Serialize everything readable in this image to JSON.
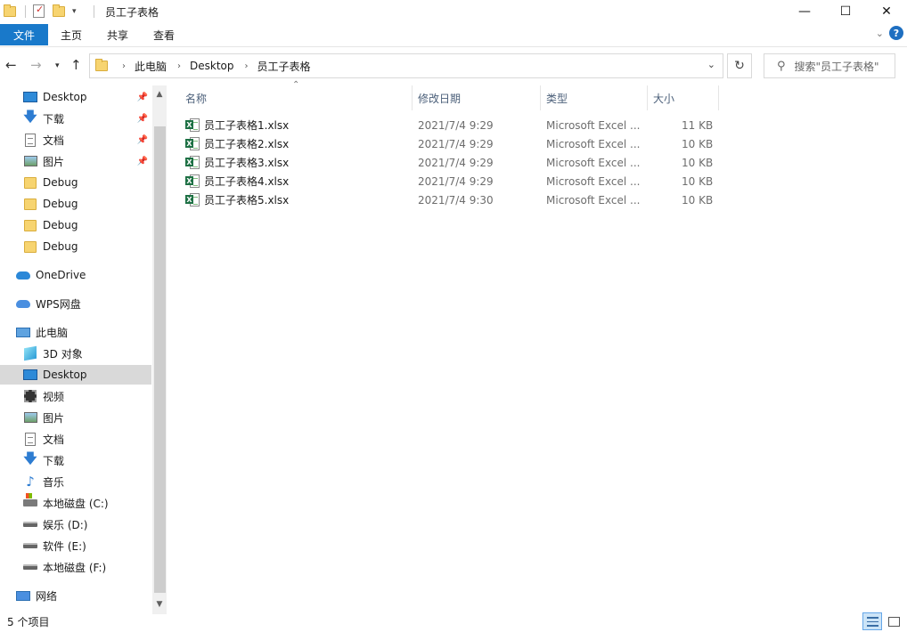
{
  "window": {
    "title": "员工子表格",
    "controls": {
      "minimize": "—",
      "maximize": "☐",
      "close": "✕"
    }
  },
  "ribbon": {
    "tabs": [
      "文件",
      "主页",
      "共享",
      "查看"
    ],
    "help": "?"
  },
  "address": {
    "breadcrumb": [
      "此电脑",
      "Desktop",
      "员工子表格"
    ],
    "search_placeholder": "搜索\"员工子表格\""
  },
  "sidebar": {
    "quick_access": [
      {
        "label": "Desktop",
        "icon": "desktop-icon",
        "pinned": true
      },
      {
        "label": "下载",
        "icon": "download-arrow-icon",
        "pinned": true
      },
      {
        "label": "文档",
        "icon": "document-icon",
        "pinned": true
      },
      {
        "label": "图片",
        "icon": "picture-icon",
        "pinned": true
      },
      {
        "label": "Debug",
        "icon": "folder-icon",
        "pinned": false
      },
      {
        "label": "Debug",
        "icon": "folder-icon",
        "pinned": false
      },
      {
        "label": "Debug",
        "icon": "folder-icon",
        "pinned": false
      },
      {
        "label": "Debug",
        "icon": "folder-icon",
        "pinned": false
      }
    ],
    "onedrive": "OneDrive",
    "wps": "WPS网盘",
    "this_pc": "此电脑",
    "pc_items": [
      {
        "label": "3D 对象",
        "icon": "3d-objects-icon"
      },
      {
        "label": "Desktop",
        "icon": "desktop-icon",
        "selected": true
      },
      {
        "label": "视频",
        "icon": "video-icon"
      },
      {
        "label": "图片",
        "icon": "picture-icon"
      },
      {
        "label": "文档",
        "icon": "document-icon"
      },
      {
        "label": "下载",
        "icon": "download-arrow-icon"
      },
      {
        "label": "音乐",
        "icon": "music-note-icon"
      },
      {
        "label": "本地磁盘 (C:)",
        "icon": "windows-drive-icon"
      },
      {
        "label": "娱乐 (D:)",
        "icon": "drive-icon"
      },
      {
        "label": "软件 (E:)",
        "icon": "drive-icon"
      },
      {
        "label": "本地磁盘 (F:)",
        "icon": "drive-icon"
      }
    ],
    "network": "网络"
  },
  "file_list": {
    "columns": [
      "名称",
      "修改日期",
      "类型",
      "大小"
    ],
    "rows": [
      {
        "name": "员工子表格1.xlsx",
        "modified": "2021/7/4 9:29",
        "type": "Microsoft Excel ...",
        "size": "11 KB"
      },
      {
        "name": "员工子表格2.xlsx",
        "modified": "2021/7/4 9:29",
        "type": "Microsoft Excel ...",
        "size": "10 KB"
      },
      {
        "name": "员工子表格3.xlsx",
        "modified": "2021/7/4 9:29",
        "type": "Microsoft Excel ...",
        "size": "10 KB"
      },
      {
        "name": "员工子表格4.xlsx",
        "modified": "2021/7/4 9:29",
        "type": "Microsoft Excel ...",
        "size": "10 KB"
      },
      {
        "name": "员工子表格5.xlsx",
        "modified": "2021/7/4 9:30",
        "type": "Microsoft Excel ...",
        "size": "10 KB"
      }
    ]
  },
  "status": {
    "item_count": "5 个项目"
  },
  "colors": {
    "file_tab": "#1979ca",
    "selection": "#d9d9d9",
    "excel_green": "#1d7044"
  }
}
